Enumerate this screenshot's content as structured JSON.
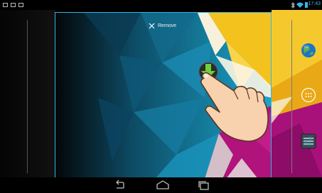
{
  "status_bar": {
    "time": "17:43",
    "left_icons": [
      "screenshot-icon",
      "gmail-icon",
      "gallery-icon"
    ],
    "right_icons": [
      "bluetooth-icon",
      "wifi-icon",
      "battery-icon"
    ],
    "accent_color": "#33b5e5"
  },
  "drop_target": {
    "label": "Remove",
    "icon": "close-icon"
  },
  "dragged_item": {
    "icon": "download-arrow-icon"
  },
  "home_icons": [
    "globe-icon",
    "apps-grid-icon",
    "settings-panel-icon"
  ],
  "nav_bar": {
    "buttons": [
      "back-icon",
      "home-icon",
      "recents-icon"
    ]
  },
  "colors": {
    "frame_border": "#33b5e5",
    "wallpaper_teal": "#1aa0c8",
    "wallpaper_yellow": "#f5c21b",
    "wallpaper_magenta": "#b2127e"
  }
}
